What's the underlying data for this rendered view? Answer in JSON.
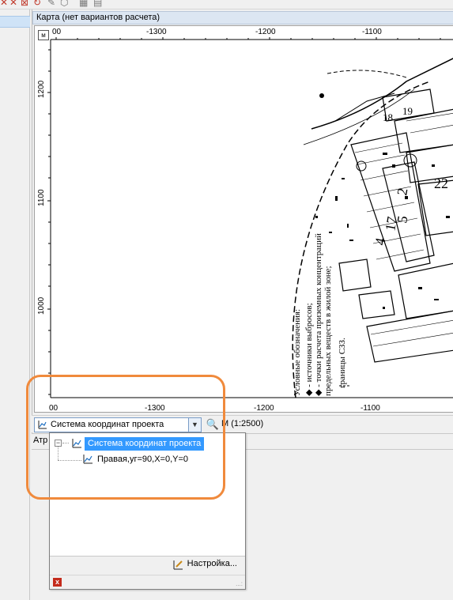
{
  "window": {
    "map_title": "Карта (нет вариантов расчета)"
  },
  "map": {
    "corner_label": "м",
    "top_ruler": [
      "00",
      "-1300",
      "-1200",
      "-1100"
    ],
    "bottom_ruler": [
      "00",
      "-1300",
      "-1200",
      "-1100"
    ],
    "left_ruler": [
      "1200",
      "1100",
      "1000"
    ],
    "legend_lines": [
      "Условные обозначения:",
      "◆ - источники выбросов;",
      "◆ - точки расчета приземных концентраций",
      "предельных веществ в жилой зоне;",
      "границы СЗЗ."
    ],
    "parcel_numbers": [
      "4",
      "17",
      "5",
      "2",
      "22",
      "18",
      "19"
    ]
  },
  "status_bar": {
    "crs_value": "Система координат проекта",
    "scale_label": "М (1:2500)"
  },
  "attributes_tab": {
    "label": "Атр"
  },
  "dropdown": {
    "tree_root_label": "Система координат проекта",
    "tree_child_label": "Правая,уг=90,X=0,Y=0",
    "settings_label": "Настройка...",
    "close_label": "x",
    "grip_label": "...:"
  },
  "colors": {
    "selection": "#3399ff",
    "highlight": "#f08a3c",
    "title_bg": "#dce6f2",
    "close_red": "#c42b1c"
  }
}
